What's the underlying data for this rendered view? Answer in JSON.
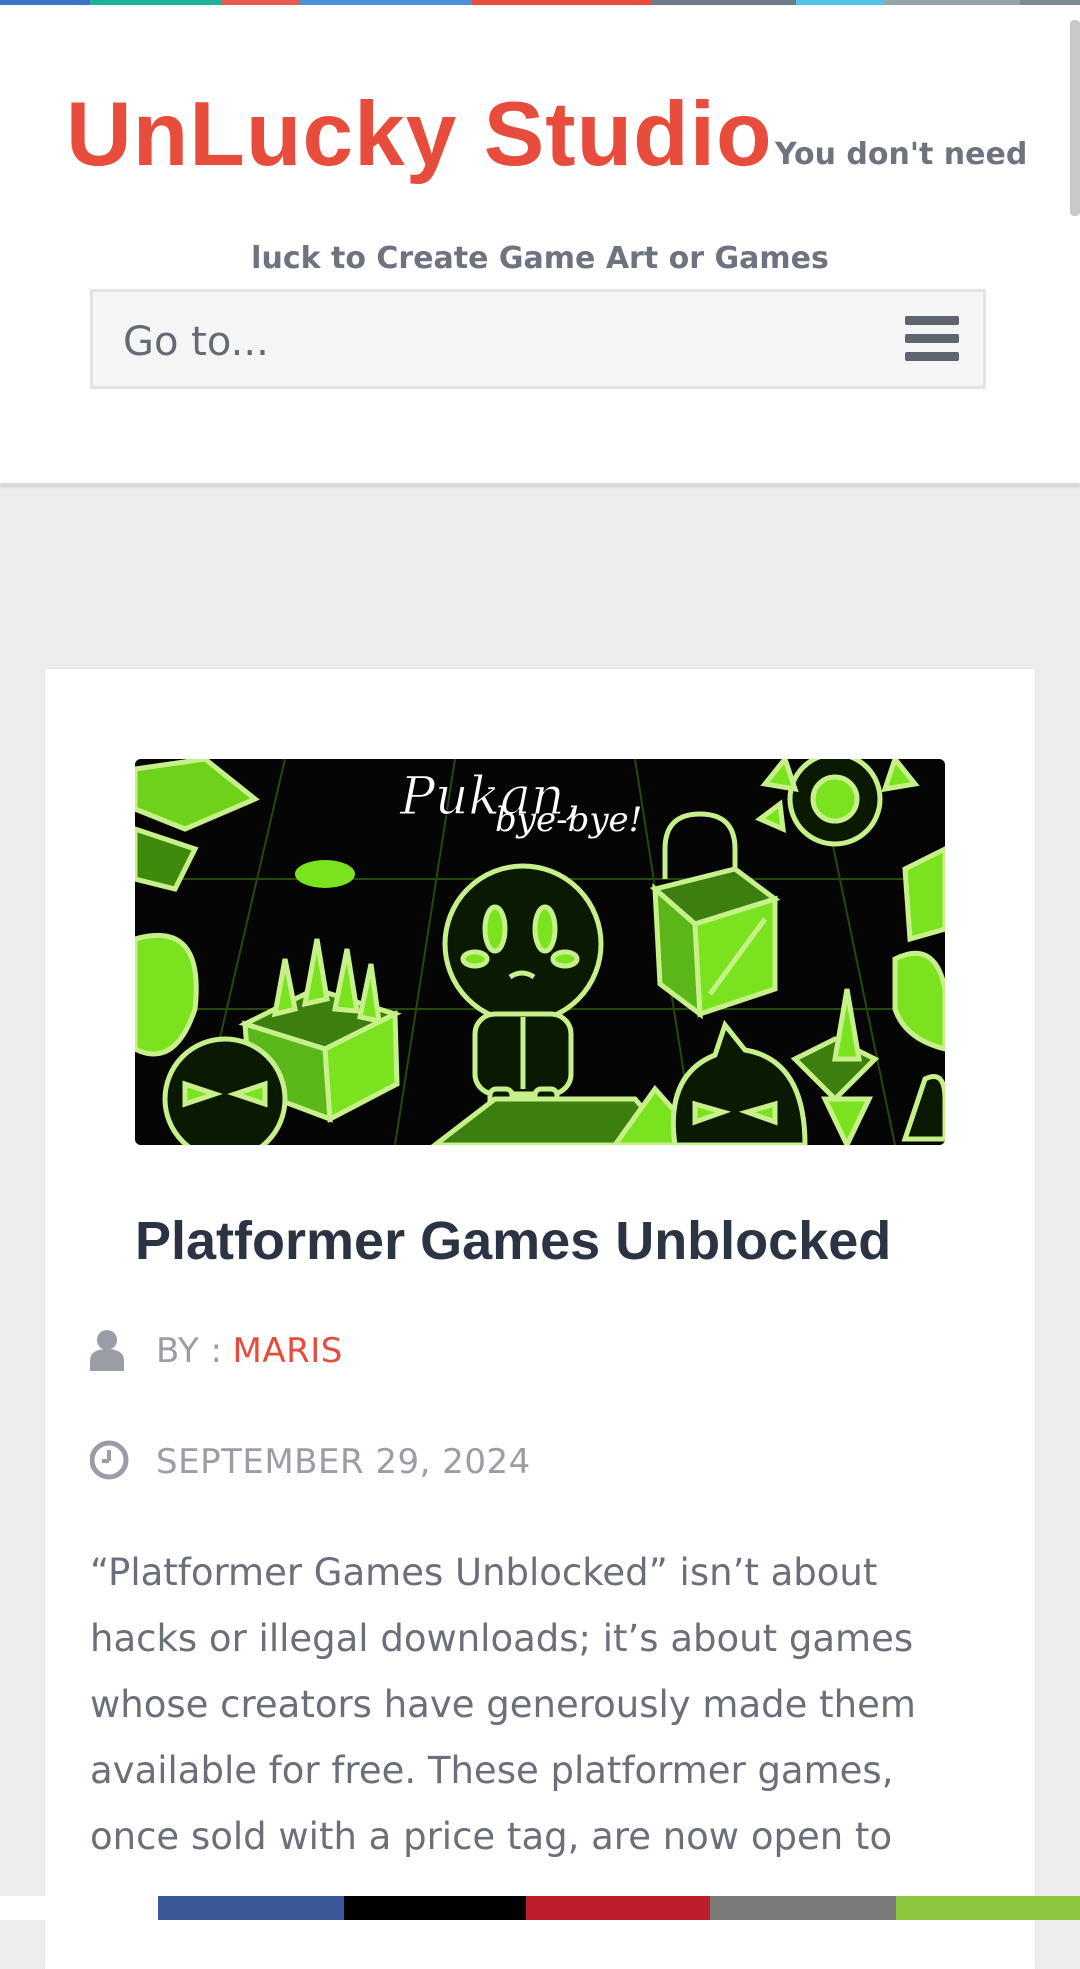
{
  "colors": {
    "brand": "#e74c3c",
    "stripe": [
      "#3b73c6",
      "#1fb39b",
      "#1fb39b",
      "#e55b52",
      "#4a90d9",
      "#4a90d9",
      "#e74c3c",
      "#e74c3c",
      "#6c7a89",
      "#4fc3e8",
      "#95a5a6",
      "#7f8c8d"
    ],
    "share": [
      "#ffffff",
      "#3b5998",
      "#000000",
      "#bd1e2c",
      "#7a7a7a",
      "#8cc63f"
    ]
  },
  "header": {
    "site_title": "UnLucky Studio",
    "tagline_part1": "You don't need",
    "tagline_part2": "luck to Create Game Art or Games",
    "menu": {
      "label": "Go to...",
      "icon": "hamburger-menu-icon"
    }
  },
  "post": {
    "image_text": [
      "Pukan,",
      "bye-bye!"
    ],
    "title": "Platformer Games Unblocked",
    "author_label": "BY :",
    "author_name": "MARIS",
    "date": "SEPTEMBER 29, 2024",
    "excerpt": "“Platformer Games Unblocked” isn’t about hacks or illegal downloads; it’s about games whose creators have generously made them available for free. These platformer games, once sold with a price tag, are now open to"
  },
  "share_bar": {
    "buttons": [
      "facebook",
      "x",
      "pinterest",
      "email",
      "share"
    ]
  }
}
